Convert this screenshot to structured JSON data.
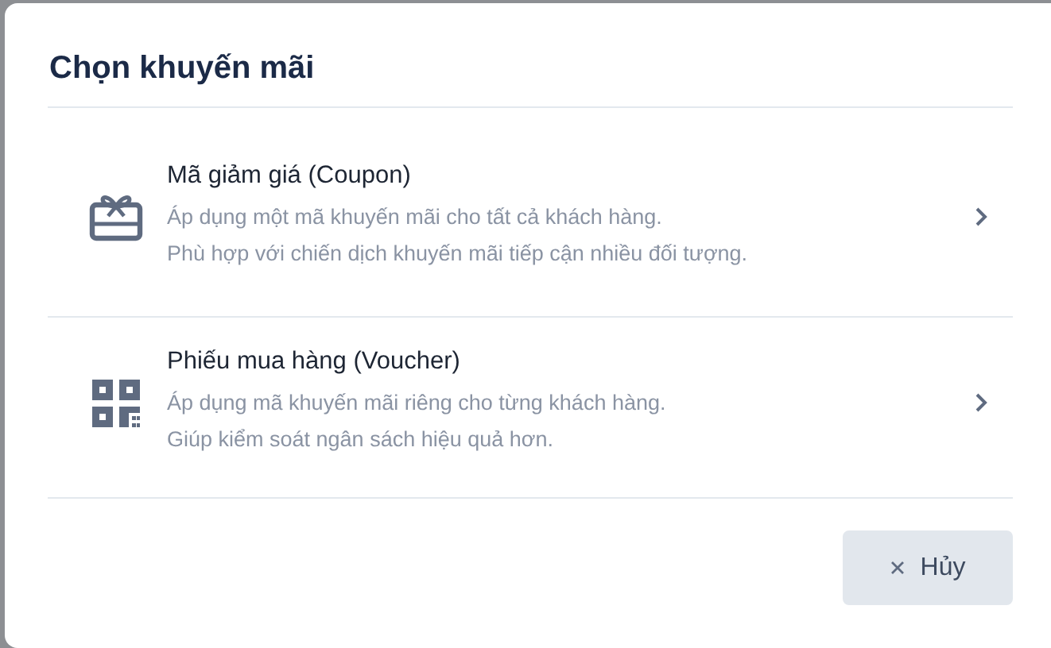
{
  "dialog": {
    "title": "Chọn khuyến mãi",
    "options": [
      {
        "kind": "coupon",
        "title": "Mã giảm giá (Coupon)",
        "description": [
          "Áp dụng một mã khuyến mãi cho tất cả khách hàng.",
          "Phù hợp với chiến dịch khuyến mãi tiếp cận nhiều đối tượng."
        ]
      },
      {
        "kind": "voucher",
        "title": "Phiếu mua hàng (Voucher)",
        "description": [
          "Áp dụng mã khuyến mãi riêng cho từng khách hàng.",
          "Giúp kiểm soát ngân sách hiệu quả hơn."
        ]
      }
    ],
    "buttons": [
      {
        "kind": "cancel",
        "label": "Hủy"
      }
    ]
  }
}
